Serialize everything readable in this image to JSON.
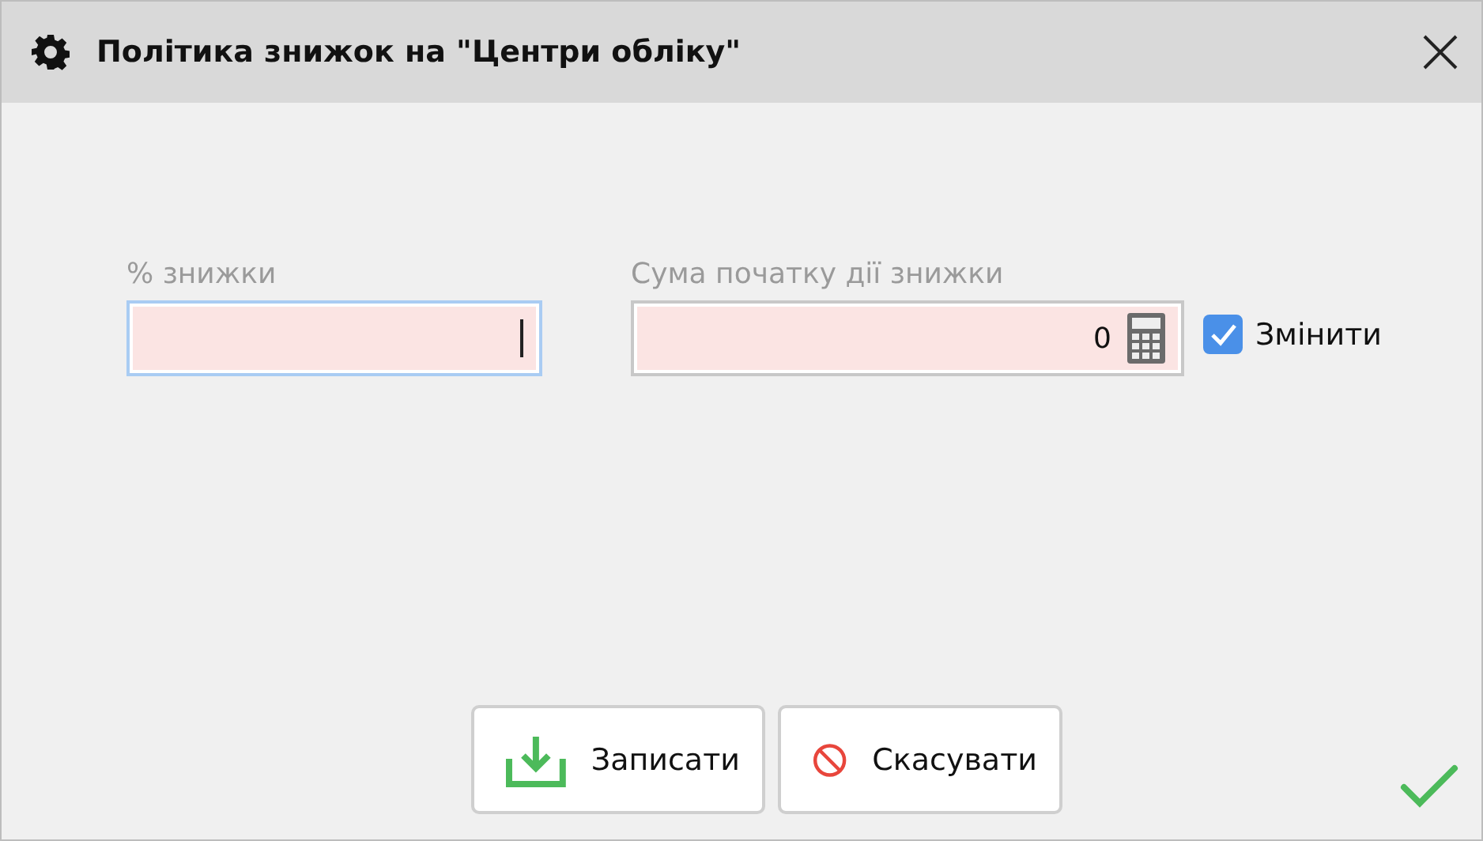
{
  "window": {
    "title": "Політика знижок на \"Центри обліку\""
  },
  "fields": [
    {
      "label": "% знижки",
      "focused": true,
      "calculator": false
    },
    {
      "label": "Сума початку дії знижки",
      "value": "0",
      "focused": false,
      "calculator": true
    }
  ],
  "checkbox": {
    "label": "Змінити",
    "checked": true
  },
  "buttons": [
    {
      "label": "Записати",
      "kind": "save"
    },
    {
      "label": "Скасувати",
      "kind": "cancel"
    }
  ]
}
